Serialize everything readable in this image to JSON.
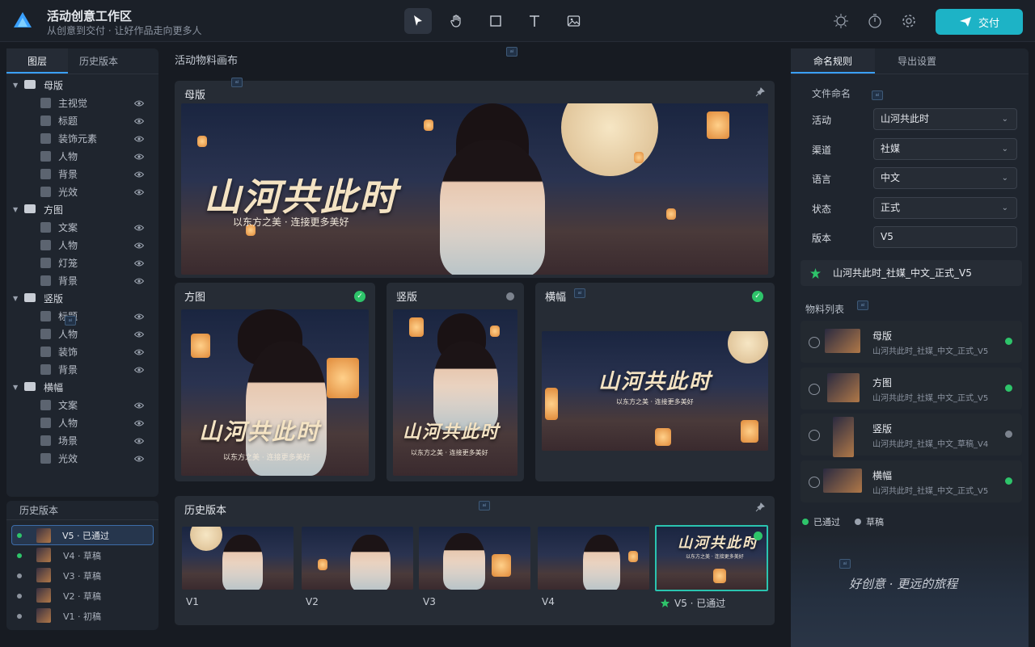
{
  "app": {
    "title": "活动创意工作区",
    "subtitle": "从创意到交付 · 让好作品走向更多人",
    "deliver_label": "交付",
    "accent": "#1db3c6"
  },
  "tools": [
    "select-tool",
    "hand-tool",
    "rectangle-tool",
    "text-tool",
    "image-tool"
  ],
  "left_tabs": [
    "图层",
    "历史版本"
  ],
  "layers": [
    {
      "group": "母版",
      "items": [
        "主视觉",
        "标题",
        "装饰元素",
        "人物",
        "背景",
        "光效"
      ]
    },
    {
      "group": "方图",
      "items": [
        "文案",
        "人物",
        "灯笼",
        "背景"
      ]
    },
    {
      "group": "竖版",
      "items": [
        "标题",
        "人物",
        "装饰",
        "背景"
      ]
    },
    {
      "group": "横幅",
      "items": [
        "文案",
        "人物",
        "场景",
        "光效"
      ]
    }
  ],
  "history_panel": {
    "title": "历史版本",
    "items": [
      {
        "label": "V5 · 已通过",
        "dot": "#2ec46a"
      },
      {
        "label": "V4 · 草稿",
        "dot": "#2ec46a"
      },
      {
        "label": "V3 · 草稿",
        "dot": "#8d949f"
      },
      {
        "label": "V2 · 草稿",
        "dot": "#8d949f"
      },
      {
        "label": "V1 · 初稿",
        "dot": "#8d949f"
      }
    ]
  },
  "canvas": {
    "title": "活动物料画布",
    "master": {
      "title": "母版",
      "headline": "山河共此时",
      "slogan": "以东方之美 · 连接更多美好"
    },
    "square": {
      "title": "方图",
      "headline": "山河共此时",
      "slogan": "以东方之美 · 连接更多美好"
    },
    "vertical": {
      "title": "竖版",
      "headline": "山河共此时",
      "slogan": "以东方之美 · 连接更多美好"
    },
    "banner": {
      "title": "横幅",
      "headline": "山河共此时",
      "slogan": "以东方之美 · 连接更多美好"
    },
    "history": {
      "title": "历史版本",
      "versions": [
        "V1",
        "V2",
        "V3",
        "V4",
        "V5 · 已通过"
      ],
      "v5_headline": "山河共此时",
      "v5_slogan": "以东方之美 · 连接更多美好"
    }
  },
  "right_tabs": [
    "命名规则",
    "导出设置"
  ],
  "naming": {
    "section": "文件命名",
    "fields": [
      {
        "label": "活动",
        "value": "山河共此时"
      },
      {
        "label": "渠道",
        "value": "社媒"
      },
      {
        "label": "语言",
        "value": "中文"
      },
      {
        "label": "状态",
        "value": "正式"
      },
      {
        "label": "版本",
        "value": "V5"
      }
    ],
    "preview": "山河共此时_社媒_中文_正式_V5"
  },
  "materials": {
    "section": "物料列表",
    "items": [
      {
        "name": "母版",
        "file": "山河共此时_社媒_中文_正式_V5",
        "status_color": "#2ec46a"
      },
      {
        "name": "方图",
        "file": "山河共此时_社媒_中文_正式_V5",
        "status_color": "#2ec46a"
      },
      {
        "name": "竖版",
        "file": "山河共此时_社媒_中文_草稿_V4",
        "status_color": "#7c838e"
      },
      {
        "name": "横幅",
        "file": "山河共此时_社媒_中文_正式_V5",
        "status_color": "#2ec46a"
      }
    ],
    "legend": [
      {
        "label": "已通过",
        "color": "#2ec46a"
      },
      {
        "label": "草稿",
        "color": "#9aa2ae"
      }
    ]
  },
  "motto": "好创意 · 更远的旅程"
}
